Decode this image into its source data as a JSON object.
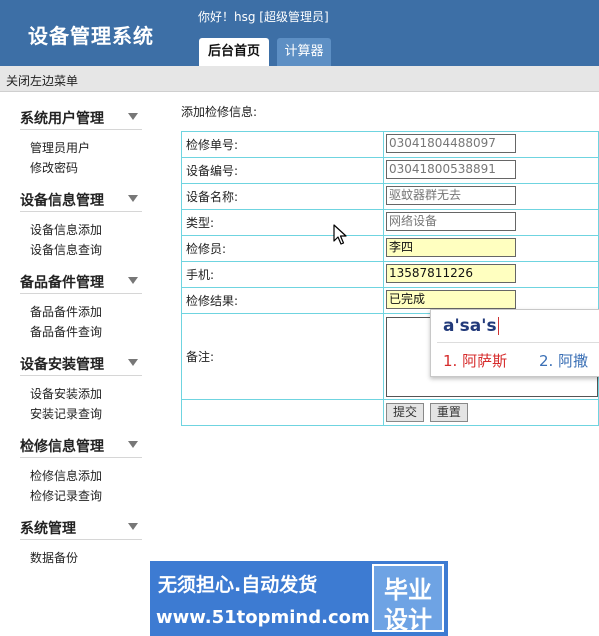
{
  "app": {
    "title": "设备管理系统",
    "greeting": "你好！hsg [超级管理员]"
  },
  "tabs": [
    {
      "label": "后台首页",
      "active": true
    },
    {
      "label": "计算器",
      "active": false
    }
  ],
  "topbar": {
    "toggle_menu": "关闭左边菜单"
  },
  "sidebar": {
    "sections": [
      {
        "title": "系统用户管理",
        "items": [
          "管理员用户",
          "修改密码"
        ]
      },
      {
        "title": "设备信息管理",
        "items": [
          "设备信息添加",
          "设备信息查询"
        ]
      },
      {
        "title": "备品备件管理",
        "items": [
          "备品备件添加",
          "备品备件查询"
        ]
      },
      {
        "title": "设备安装管理",
        "items": [
          "设备安装添加",
          "安装记录查询"
        ]
      },
      {
        "title": "检修信息管理",
        "items": [
          "检修信息添加",
          "检修记录查询"
        ]
      },
      {
        "title": "系统管理",
        "items": [
          "数据备份"
        ]
      }
    ]
  },
  "form": {
    "title": "添加检修信息:",
    "fields": [
      {
        "label": "检修单号:",
        "value": "03041804488097"
      },
      {
        "label": "设备编号:",
        "value": "03041800538891"
      },
      {
        "label": "设备名称:",
        "value": "驱蚊器群无去"
      },
      {
        "label": "类型:",
        "value": "网络设备"
      },
      {
        "label": "检修员:",
        "value": "李四"
      },
      {
        "label": "手机:",
        "value": "13587811226"
      },
      {
        "label": "检修结果:",
        "value": "已完成"
      }
    ],
    "remark_label": "备注:",
    "remark_value": "",
    "submit_label": "提交",
    "reset_label": "重置"
  },
  "ime": {
    "composition": "a'sa's",
    "candidates": [
      "1. 阿萨斯",
      "2. 阿撒"
    ]
  },
  "banner": {
    "line1": "无须担心.自动发货",
    "line2": "www.51topmind.com",
    "box_line1": "毕业",
    "box_line2": "设计"
  },
  "colors": {
    "header": "#3d6fa6",
    "table_border": "#6fd4e0",
    "highlight_field": "#ffffc0",
    "banner": "#3d7bd2"
  }
}
